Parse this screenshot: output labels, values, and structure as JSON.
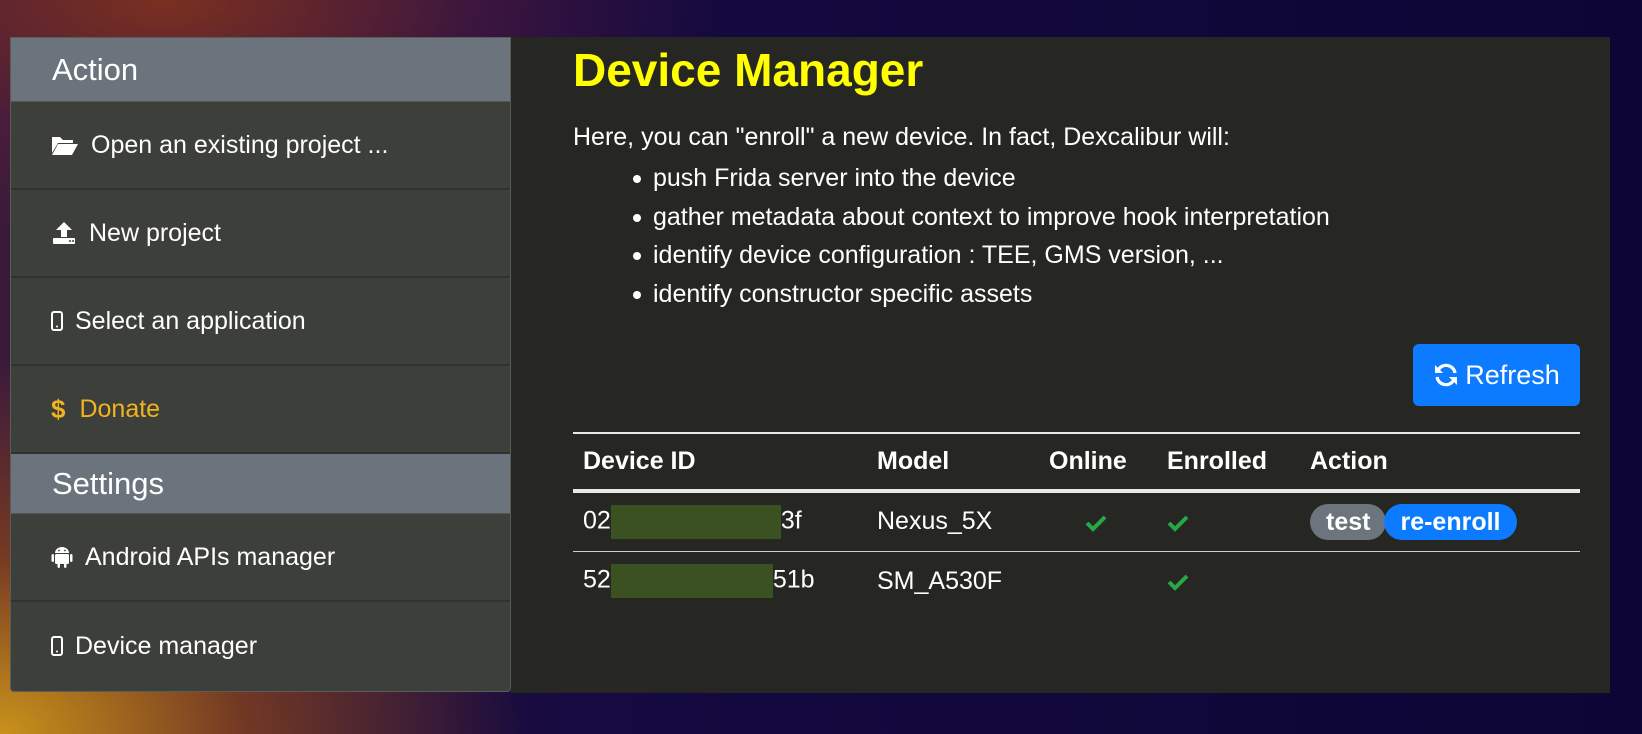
{
  "sidebar": {
    "action_header": "Action",
    "action_items": [
      {
        "label": "Open an existing project ...",
        "icon": "folder-open-icon"
      },
      {
        "label": "New project",
        "icon": "upload-icon"
      },
      {
        "label": "Select an application",
        "icon": "mobile-icon"
      },
      {
        "label": "Donate",
        "icon": "dollar-icon",
        "color": "#f2b320"
      }
    ],
    "settings_header": "Settings",
    "settings_items": [
      {
        "label": "Android APIs manager",
        "icon": "android-icon"
      },
      {
        "label": "Device manager",
        "icon": "mobile-icon"
      }
    ]
  },
  "main": {
    "title": "Device Manager",
    "title_color": "#ffff00",
    "intro": "Here, you can \"enroll\" a new device. In fact, Dexcalibur will:",
    "bullets": [
      "push Frida server into the device",
      "gather metadata about context to improve hook interpretation",
      "identify device configuration : TEE, GMS version, ...",
      "identify constructor specific assets"
    ],
    "refresh_label": "Refresh",
    "table": {
      "headers": [
        "Device ID",
        "Model",
        "Online",
        "Enrolled",
        "Action"
      ],
      "rows": [
        {
          "id_prefix": "02",
          "id_suffix": "3f",
          "model": "Nexus_5X",
          "online": true,
          "enrolled": true,
          "actions": [
            "test",
            "re-enroll"
          ]
        },
        {
          "id_prefix": "52",
          "id_suffix": "51b",
          "model": "SM_A530F",
          "online": false,
          "enrolled": true,
          "actions": []
        }
      ]
    }
  },
  "colors": {
    "accent": "#0d7bff",
    "check": "#28a745",
    "donate": "#f2b320",
    "badge_grey": "#6c757d"
  }
}
